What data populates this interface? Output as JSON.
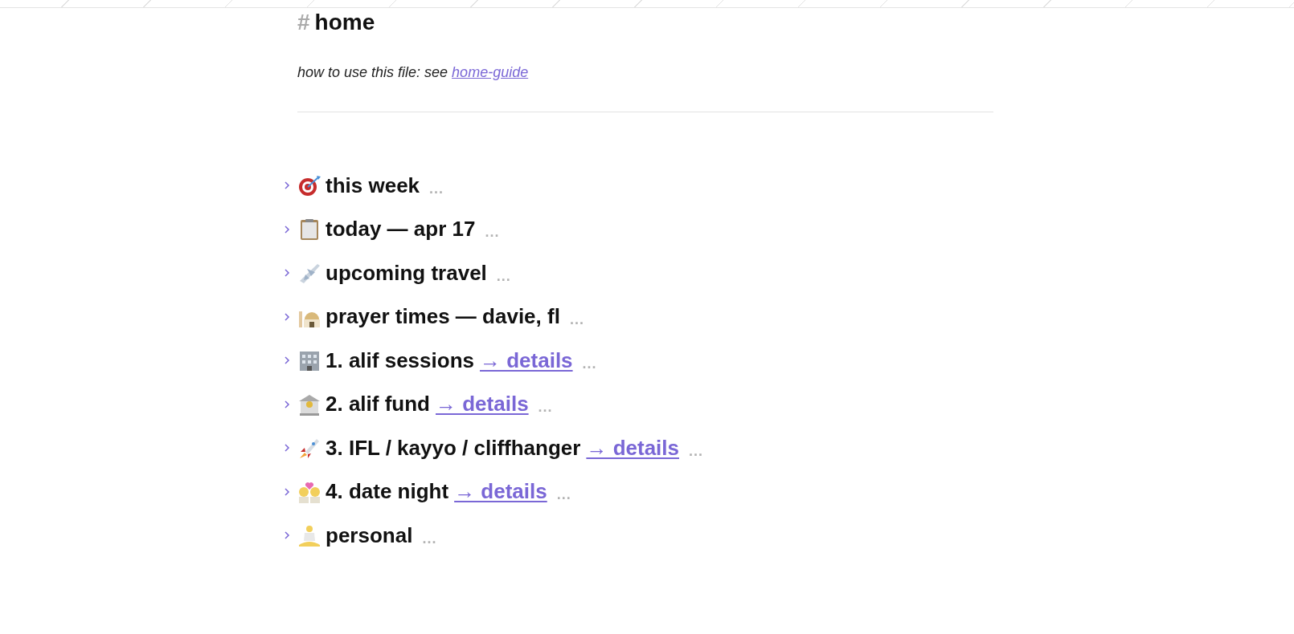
{
  "heading": {
    "hash": "#",
    "title": "home"
  },
  "intro": {
    "text": "how to use this file: see",
    "link": "home-guide"
  },
  "sections": [
    {
      "title": "this week",
      "more": "...",
      "expanded": false
    },
    {
      "title": "today — apr 17",
      "more": "...",
      "expanded": false
    },
    {
      "title": "upcoming travel",
      "more": "...",
      "expanded": false
    },
    {
      "title": "prayer times — davie, fl",
      "more": "...",
      "expanded": false
    },
    {
      "title": "1. alif sessions",
      "link": "→ details",
      "more": "...",
      "expanded": false
    },
    {
      "title": "2. alif fund",
      "link": "→ details",
      "more": "...",
      "expanded": false
    },
    {
      "title": "3. IFL / kayyo / cliffhanger",
      "link": "→ details",
      "more": "...",
      "expanded": false
    },
    {
      "title": "4. date night",
      "link": "→ details",
      "more": "...",
      "expanded": false
    },
    {
      "title": "personal",
      "more": "...",
      "expanded": false
    }
  ]
}
